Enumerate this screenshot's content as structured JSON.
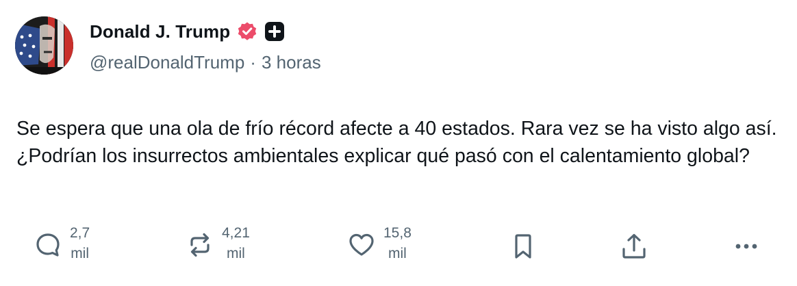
{
  "author": {
    "display_name": "Donald J. Trump",
    "handle": "@realDonaldTrump",
    "separator": "·",
    "time": "3 horas"
  },
  "post": {
    "text": "Se espera que una ola de frío récord afecte a 40 estados. Rara vez se ha visto algo así. ¿Podrían los insurrectos ambientales explicar qué pasó con el calentamiento global?"
  },
  "actions": {
    "replies": {
      "number": "2,7",
      "unit": "mil"
    },
    "reposts": {
      "number": "4,21",
      "unit": "mil"
    },
    "likes": {
      "number": "15,8",
      "unit": "mil"
    }
  },
  "icons": {
    "verified": "verified-badge-icon",
    "plus": "plus-badge-icon",
    "reply": "speech-bubble-icon",
    "repost": "repost-arrows-icon",
    "like": "heart-icon",
    "bookmark": "bookmark-icon",
    "share": "share-upload-icon",
    "more": "more-dots-icon"
  },
  "colors": {
    "verified_badge": "#ec4c6a",
    "text_primary": "#0f1419",
    "text_secondary": "#536471"
  }
}
